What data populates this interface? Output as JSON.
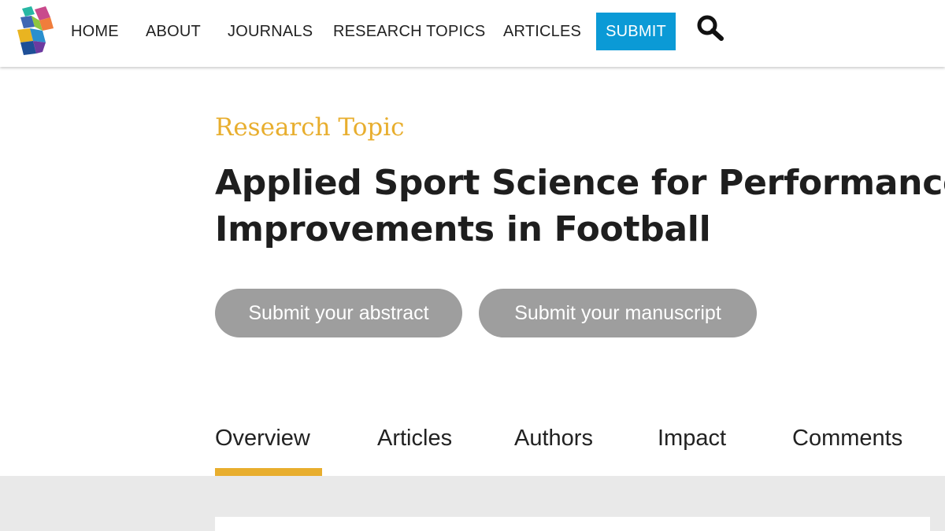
{
  "nav": {
    "items": [
      {
        "label": "HOME"
      },
      {
        "label": "ABOUT"
      },
      {
        "label": "JOURNALS"
      },
      {
        "label": "RESEARCH TOPICS"
      },
      {
        "label": "ARTICLES"
      }
    ],
    "submit_label": "SUBMIT",
    "submit_color": "#0b9ad6",
    "search_icon": "magnifier-icon",
    "logo_icon": "stacked-cubes-logo"
  },
  "hero": {
    "kicker": "Research Topic",
    "kicker_color": "#e8ae2e",
    "title_line1": "Applied Sport Science for Performance",
    "title_line2": "Improvements in Football",
    "actions": {
      "abstract_label": "Submit your abstract",
      "manuscript_label": "Submit your manuscript"
    }
  },
  "tabs": [
    {
      "label": "Overview",
      "active": true
    },
    {
      "label": "Articles",
      "active": false
    },
    {
      "label": "Authors",
      "active": false
    },
    {
      "label": "Impact",
      "active": false
    },
    {
      "label": "Comments",
      "active": false
    }
  ],
  "colors": {
    "accent": "#e8ae2e",
    "button_gray": "#9e9e9e",
    "content_background": "#e9e9e9"
  }
}
